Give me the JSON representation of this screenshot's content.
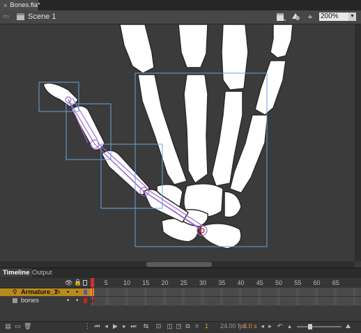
{
  "document": {
    "tab_title": "Bones.fla*",
    "close_glyph": "×"
  },
  "editbar": {
    "scene_label": "Scene 1",
    "zoom_value": "200%"
  },
  "panel_tabs": [
    "Timeline",
    "Output"
  ],
  "timeline": {
    "frame_numbers": [
      "1",
      "5",
      "10",
      "15",
      "20",
      "25",
      "30",
      "35",
      "40",
      "45",
      "50",
      "55",
      "60",
      "65"
    ],
    "layers": [
      {
        "name": "Armature_1",
        "type": "armature",
        "selected": true
      },
      {
        "name": "bones",
        "type": "normal",
        "selected": false
      }
    ],
    "current_frame": "1",
    "fps": "24.00 fps",
    "elapsed": "0.0 s"
  },
  "colors": {
    "stage_bg": "#3b3b3b",
    "bone_fill": "#ffffff",
    "armature_line": "#9b6bd1",
    "bbox": "#6aa6d6",
    "layer_selected": "#b88a1e",
    "playhead": "#d03030"
  },
  "icons": [
    "close-icon",
    "back-arrow-icon",
    "scene-clapper-icon",
    "clapper-dropdown-icon",
    "symbol-dropdown-icon",
    "center-stage-icon",
    "chevron-down-icon",
    "eye-icon",
    "lock-icon",
    "outline-icon",
    "bone-tool-icon",
    "pencil-icon",
    "new-layer-icon",
    "new-folder-icon",
    "delete-icon",
    "first-frame-icon",
    "step-back-icon",
    "play-icon",
    "step-forward-icon",
    "last-frame-icon",
    "loop-icon",
    "onion-skin-icon",
    "edit-multiple-frames-icon"
  ]
}
